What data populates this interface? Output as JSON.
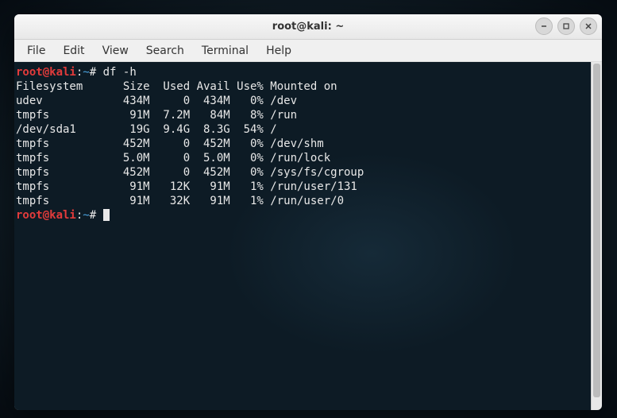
{
  "window": {
    "title": "root@kali: ~"
  },
  "menubar": {
    "items": [
      "File",
      "Edit",
      "View",
      "Search",
      "Terminal",
      "Help"
    ]
  },
  "prompt": {
    "user_host": "root@kali",
    "sep": ":",
    "path": "~",
    "char": "#"
  },
  "command": "df -h",
  "output_header": "Filesystem      Size  Used Avail Use% Mounted on",
  "output_rows": [
    "udev            434M     0  434M   0% /dev",
    "tmpfs            91M  7.2M   84M   8% /run",
    "/dev/sda1        19G  9.4G  8.3G  54% /",
    "tmpfs           452M     0  452M   0% /dev/shm",
    "tmpfs           5.0M     0  5.0M   0% /run/lock",
    "tmpfs           452M     0  452M   0% /sys/fs/cgroup",
    "tmpfs            91M   12K   91M   1% /run/user/131",
    "tmpfs            91M   32K   91M   1% /run/user/0"
  ],
  "colors": {
    "prompt_user": "#e23b3b",
    "prompt_path": "#4aa3df",
    "terminal_bg": "#0d1b25",
    "terminal_fg": "#e8e8e8"
  }
}
